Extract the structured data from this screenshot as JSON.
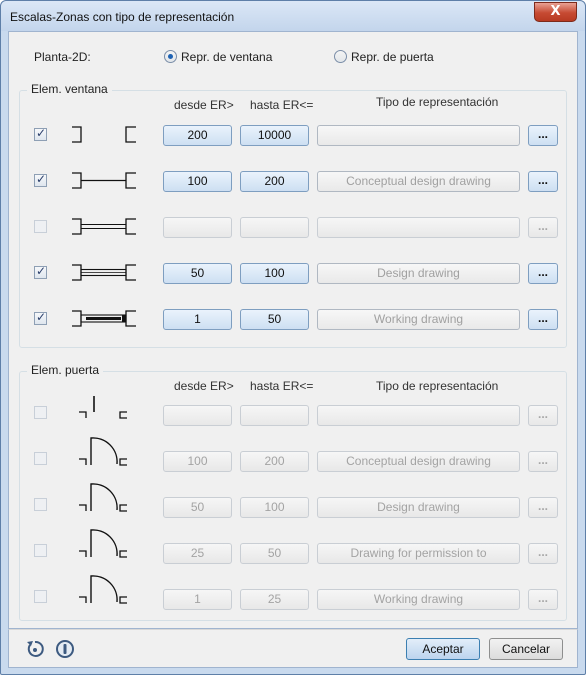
{
  "window": {
    "title": "Escalas-Zonas con tipo de representación",
    "close_glyph": "X"
  },
  "planta": {
    "label": "Planta-2D:",
    "options": [
      {
        "label": "Repr. de ventana",
        "selected": true
      },
      {
        "label": "Repr. de puerta",
        "selected": false
      }
    ]
  },
  "ventana": {
    "title": "Elem. ventana",
    "headers": {
      "desde": "desde ER>",
      "hasta": "hasta ER<=",
      "tipo": "Tipo de representación"
    },
    "rows": [
      {
        "checked": true,
        "enabled": true,
        "icon": "window-symbol-opening-icon",
        "desde": "200",
        "hasta": "10000",
        "tipo": ""
      },
      {
        "checked": true,
        "enabled": true,
        "icon": "window-symbol-single-line-icon",
        "desde": "100",
        "hasta": "200",
        "tipo": "Conceptual design drawing"
      },
      {
        "checked": false,
        "enabled": false,
        "icon": "window-symbol-double-line-icon",
        "desde": "",
        "hasta": "",
        "tipo": ""
      },
      {
        "checked": true,
        "enabled": true,
        "icon": "window-symbol-sill-icon",
        "desde": "50",
        "hasta": "100",
        "tipo": "Design drawing"
      },
      {
        "checked": true,
        "enabled": true,
        "icon": "window-symbol-detailed-icon",
        "desde": "1",
        "hasta": "50",
        "tipo": "Working drawing"
      }
    ],
    "more_label": "..."
  },
  "puerta": {
    "title": "Elem. puerta",
    "headers": {
      "desde": "desde ER>",
      "hasta": "hasta ER<=",
      "tipo": "Tipo de representación"
    },
    "rows": [
      {
        "checked": false,
        "enabled": false,
        "icon": "door-symbol-leaf-icon",
        "desde": "",
        "hasta": "",
        "tipo": ""
      },
      {
        "checked": false,
        "enabled": false,
        "icon": "door-symbol-swing-icon",
        "desde": "100",
        "hasta": "200",
        "tipo": "Conceptual design drawing"
      },
      {
        "checked": false,
        "enabled": false,
        "icon": "door-symbol-swing-icon",
        "desde": "50",
        "hasta": "100",
        "tipo": "Design drawing"
      },
      {
        "checked": false,
        "enabled": false,
        "icon": "door-symbol-swing-icon",
        "desde": "25",
        "hasta": "50",
        "tipo": "Drawing for permission to"
      },
      {
        "checked": false,
        "enabled": false,
        "icon": "door-symbol-swing-icon",
        "desde": "1",
        "hasta": "25",
        "tipo": "Working drawing"
      }
    ],
    "more_label": "..."
  },
  "footer": {
    "icons": [
      "reset-icon",
      "info-icon"
    ],
    "ok_label": "Aceptar",
    "cancel_label": "Cancelar"
  }
}
